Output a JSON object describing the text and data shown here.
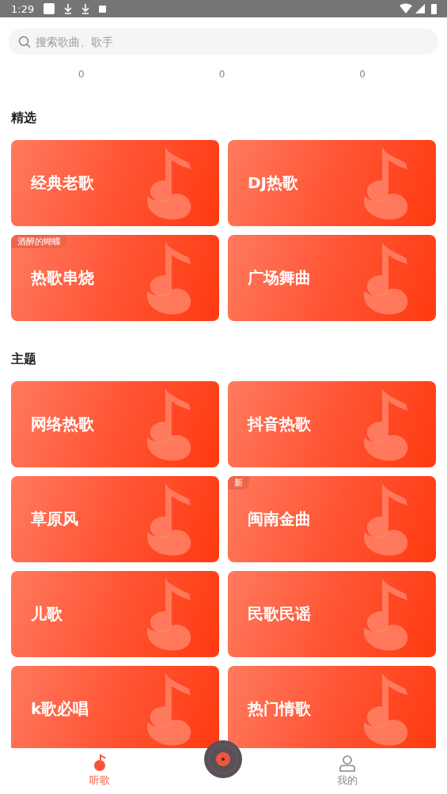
{
  "status_bar": {
    "time": "1:29"
  },
  "search": {
    "placeholder": "搜索歌曲、歌手"
  },
  "counts": [
    "0",
    "0",
    "0"
  ],
  "sections": [
    {
      "title": "精选",
      "cards": [
        {
          "label": "经典老歌"
        },
        {
          "label": "DJ热歌"
        },
        {
          "label": "热歌串烧",
          "badge": "酒醉的蝴蝶"
        },
        {
          "label": "广场舞曲"
        }
      ]
    },
    {
      "title": "主题",
      "cards": [
        {
          "label": "网络热歌"
        },
        {
          "label": "抖音热歌"
        },
        {
          "label": "草原风"
        },
        {
          "label": "闽南金曲",
          "badge": "新"
        },
        {
          "label": "儿歌"
        },
        {
          "label": "民歌民谣"
        },
        {
          "label": "k歌必唱"
        },
        {
          "label": "热门情歌"
        }
      ]
    }
  ],
  "tabs": [
    {
      "label": "听歌",
      "selected": true
    },
    {
      "label": "我的",
      "selected": false
    }
  ]
}
